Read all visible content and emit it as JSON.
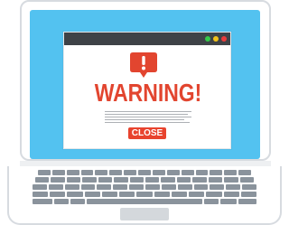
{
  "window": {
    "controls": [
      "minimize",
      "maximize",
      "close"
    ]
  },
  "alert": {
    "icon": "exclamation-alert-icon",
    "title": "WARNING!",
    "button_label": "CLOSE"
  },
  "colors": {
    "screen": "#53c2f0",
    "accent": "#e2452f",
    "titlebar": "#3e4247"
  }
}
